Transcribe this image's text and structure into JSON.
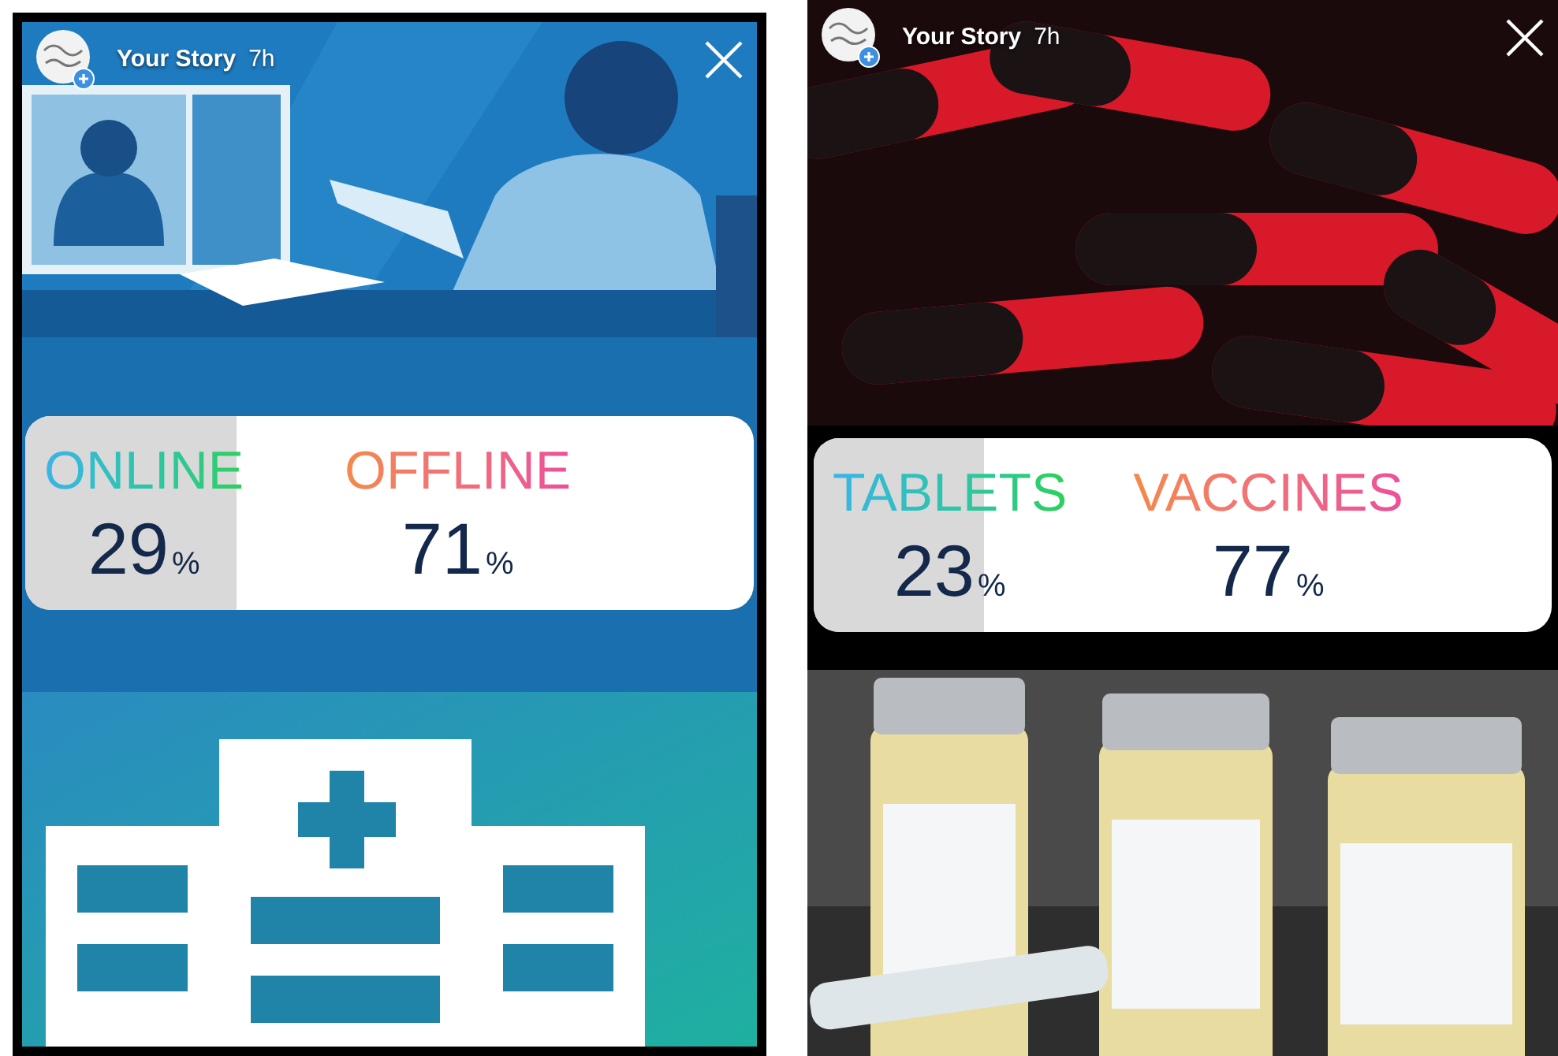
{
  "stories": [
    {
      "kind": "illustrated",
      "header": {
        "title": "Your Story",
        "time": "7h"
      },
      "poll": {
        "level": 0.29,
        "options": [
          {
            "label": "ONLINE",
            "percent": "29",
            "unit": "%"
          },
          {
            "label": "OFFLINE",
            "percent": "71",
            "unit": "%"
          }
        ]
      }
    },
    {
      "header": {
        "title": "Your Story",
        "time": "7h"
      },
      "poll": {
        "level": 0.23,
        "options": [
          {
            "label": "TABLETS",
            "percent": "23",
            "unit": "%"
          },
          {
            "label": "VACCINES",
            "percent": "77",
            "unit": "%"
          }
        ]
      }
    }
  ]
}
